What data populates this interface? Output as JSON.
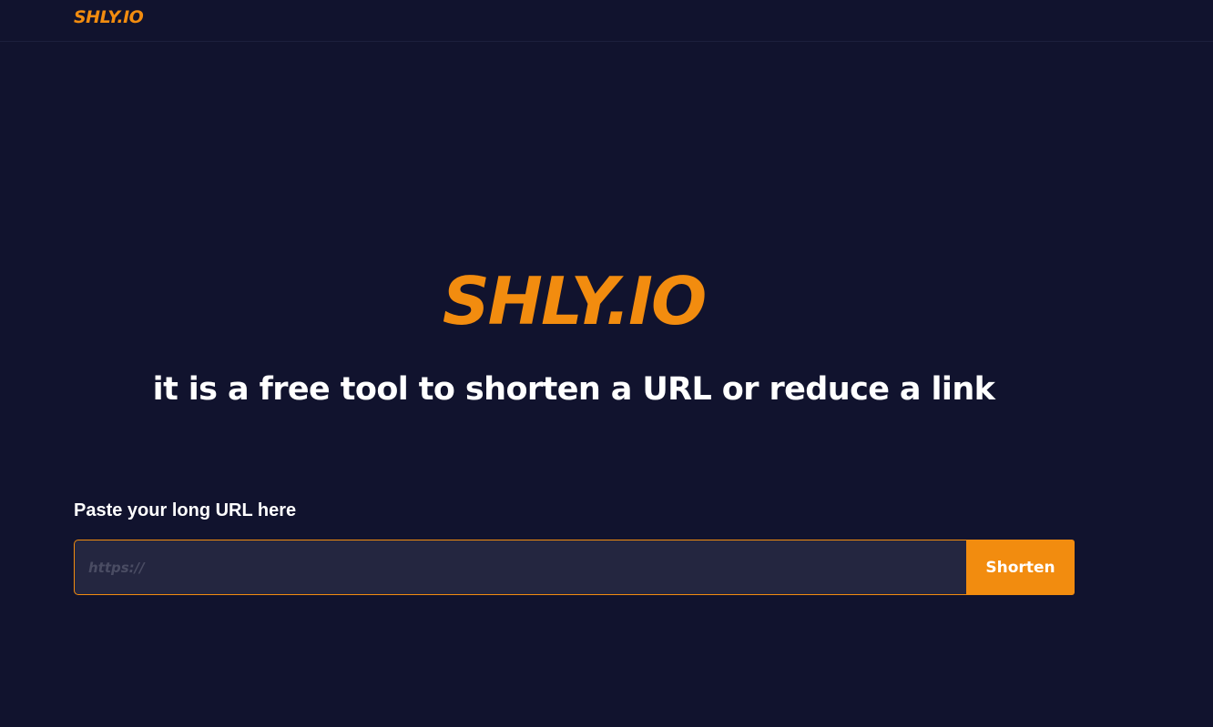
{
  "navbar": {
    "logo": "SHLY.IO"
  },
  "hero": {
    "logo": "SHLY.IO",
    "tagline": "it is a free tool to shorten a URL or reduce a link"
  },
  "form": {
    "label": "Paste your long URL here",
    "input_value": "",
    "input_placeholder": "https://",
    "button_label": "Shorten"
  },
  "colors": {
    "background": "#11132e",
    "accent": "#f28c0f",
    "input_background": "#242640",
    "text": "#ffffff"
  }
}
